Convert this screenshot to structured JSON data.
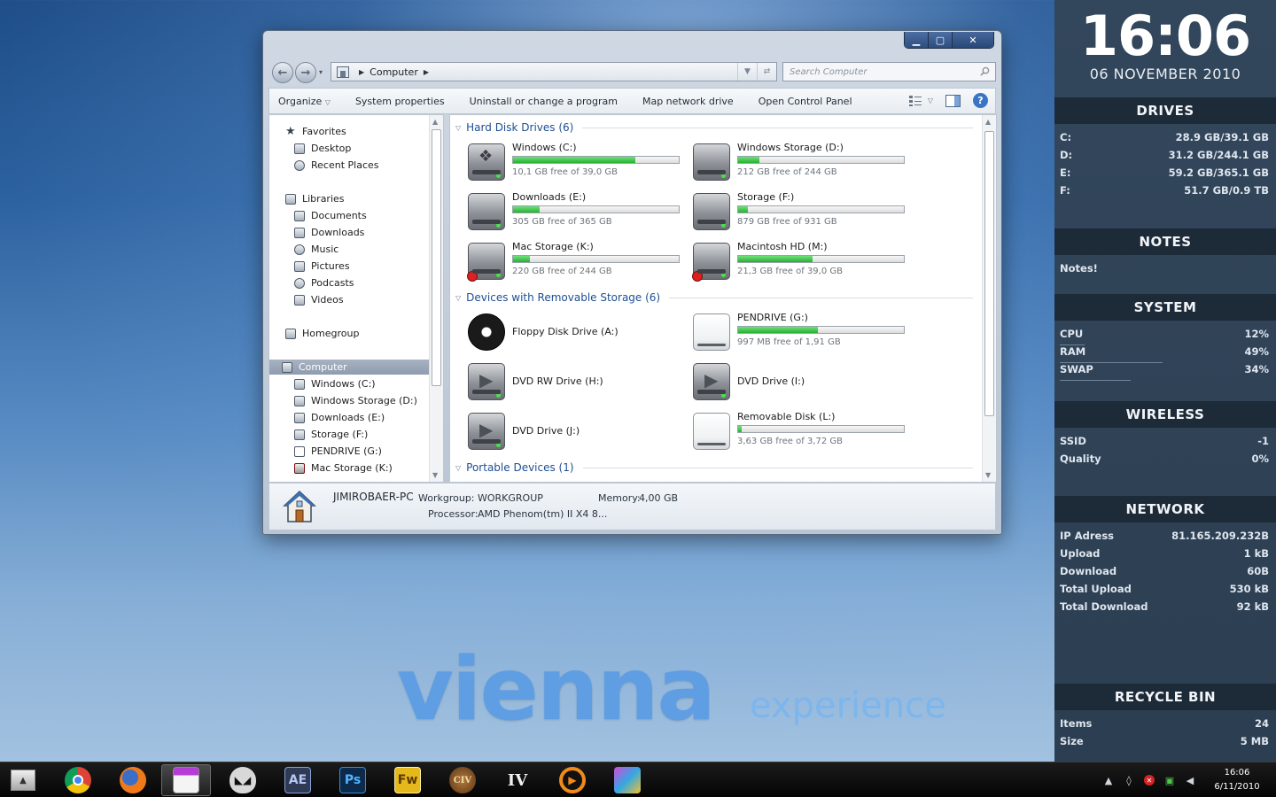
{
  "window": {
    "address": {
      "crumb": "Computer"
    },
    "search_placeholder": "Search Computer",
    "toolbar": {
      "organize": "Organize",
      "system_properties": "System properties",
      "uninstall": "Uninstall or change a program",
      "map_drive": "Map network drive",
      "control_panel": "Open Control Panel"
    },
    "nav": {
      "favorites": "Favorites",
      "desktop": "Desktop",
      "recent": "Recent Places",
      "libraries": "Libraries",
      "documents": "Documents",
      "downloads": "Downloads",
      "music": "Music",
      "pictures": "Pictures",
      "podcasts": "Podcasts",
      "videos": "Videos",
      "homegroup": "Homegroup",
      "computer": "Computer",
      "c": "Windows (C:)",
      "d": "Windows Storage (D:)",
      "e": "Downloads (E:)",
      "f": "Storage (F:)",
      "g": "PENDRIVE (G:)",
      "k": "Mac Storage (K:)"
    },
    "groups": {
      "hdd": "Hard Disk Drives (6)",
      "removable": "Devices with Removable Storage (6)",
      "portable": "Portable Devices (1)"
    },
    "drives": {
      "c": {
        "name": "Windows (C:)",
        "free": "10,1 GB free of 39,0 GB",
        "used_pct": 74
      },
      "d": {
        "name": "Windows Storage (D:)",
        "free": "212 GB free of 244 GB",
        "used_pct": 13
      },
      "e": {
        "name": "Downloads (E:)",
        "free": "305 GB free of 365 GB",
        "used_pct": 16
      },
      "f": {
        "name": "Storage (F:)",
        "free": "879 GB free of 931 GB",
        "used_pct": 6
      },
      "k": {
        "name": "Mac Storage (K:)",
        "free": "220 GB free of 244 GB",
        "used_pct": 10
      },
      "m": {
        "name": "Macintosh HD (M:)",
        "free": "21,3 GB free of 39,0 GB",
        "used_pct": 45
      },
      "a": {
        "name": "Floppy Disk Drive (A:)"
      },
      "g": {
        "name": "PENDRIVE (G:)",
        "free": "997 MB free of 1,91 GB",
        "used_pct": 48
      },
      "h": {
        "name": "DVD RW Drive (H:)"
      },
      "i": {
        "name": "DVD Drive (I:)"
      },
      "j": {
        "name": "DVD Drive (J:)"
      },
      "l": {
        "name": "Removable Disk (L:)",
        "free": "3,63 GB free of 3,72 GB",
        "used_pct": 2
      }
    },
    "details": {
      "pc_name": "JIMIROBAER-PC",
      "workgroup_label": "Workgroup:",
      "workgroup": "WORKGROUP",
      "memory_label": "Memory:",
      "memory": "4,00 GB",
      "processor_label": "Processor:",
      "processor": "AMD Phenom(tm) II X4 8..."
    }
  },
  "logo": {
    "main": "vienna",
    "sub": "experience"
  },
  "sidebar": {
    "time": "16:06",
    "date": "06 NOVEMBER 2010",
    "drives_title": "DRIVES",
    "drives": [
      {
        "k": "C:",
        "v": "28.9 GB/39.1 GB"
      },
      {
        "k": "D:",
        "v": "31.2 GB/244.1 GB"
      },
      {
        "k": "E:",
        "v": "59.2 GB/365.1 GB"
      },
      {
        "k": "F:",
        "v": "51.7 GB/0.9 TB"
      }
    ],
    "notes_title": "NOTES",
    "notes": "Notes!",
    "system_title": "SYSTEM",
    "system": [
      {
        "k": "CPU",
        "v": "12%",
        "pct": 12
      },
      {
        "k": "RAM",
        "v": "49%",
        "pct": 49
      },
      {
        "k": "SWAP",
        "v": "34%",
        "pct": 34
      }
    ],
    "wireless_title": "WIRELESS",
    "wireless": [
      {
        "k": "SSID",
        "v": "-1"
      },
      {
        "k": "Quality",
        "v": "0%"
      }
    ],
    "network_title": "NETWORK",
    "network": [
      {
        "k": "IP Adress",
        "v": "81.165.209.232B"
      },
      {
        "k": "Upload",
        "v": "1 kB"
      },
      {
        "k": "Download",
        "v": "60B"
      },
      {
        "k": "Total Upload",
        "v": "530 kB"
      },
      {
        "k": "Total Download",
        "v": "92 kB"
      }
    ],
    "recycle_title": "RECYCLE BIN",
    "recycle": [
      {
        "k": "Items",
        "v": "24"
      },
      {
        "k": "Size",
        "v": "5 MB"
      }
    ]
  },
  "taskbar": {
    "apps": [
      "chrome-icon",
      "firefox-icon",
      "explorer-icon",
      "alien-icon",
      "after-effects-icon",
      "photoshop-icon",
      "fireworks-icon",
      "civ-icon",
      "gta-iv-icon",
      "media-player-icon",
      "package-icon"
    ],
    "ae_label": "AE",
    "ps_label": "Ps",
    "fw_label": "Fw",
    "civ_label": "CIV",
    "iv_label": "IV",
    "time": "16:06",
    "date": "6/11/2010"
  },
  "colors": {
    "accent_blue": "#1d4f94",
    "bar_green": "#27b033",
    "sidebar_bg": "#2c3e51",
    "sidebar_head": "#1d2a38"
  }
}
